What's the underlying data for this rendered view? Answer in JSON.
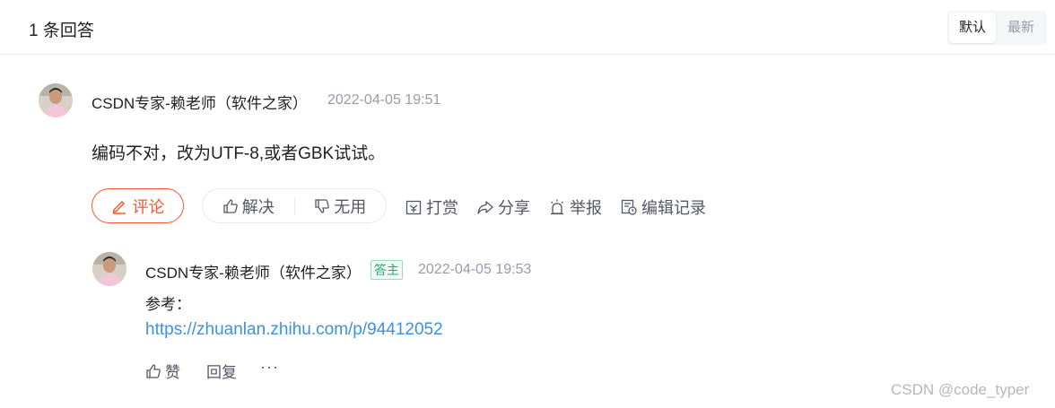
{
  "header": {
    "answer_count": "1 条回答",
    "sort_options": [
      "默认",
      "最新"
    ],
    "active_sort": "默认"
  },
  "answer": {
    "author": "CSDN专家-赖老师（软件之家）",
    "time": "2022-04-05 19:51",
    "content": "编码不对，改为UTF-8,或者GBK试试。",
    "actions": {
      "comment": "评论",
      "solve": "解决",
      "useless": "无用",
      "reward": "打赏",
      "share": "分享",
      "report": "举报",
      "edit_history": "编辑记录"
    }
  },
  "reply": {
    "author": "CSDN专家-赖老师（软件之家）",
    "badge": "答主",
    "time": "2022-04-05 19:53",
    "text": "参考：",
    "link": "https://zhuanlan.zhihu.com/p/94412052",
    "actions": {
      "like": "赞",
      "reply": "回复",
      "more": "···"
    }
  },
  "watermark": "CSDN @code_typer",
  "colors": {
    "accent": "#fc5531",
    "link": "#3e90e0",
    "badge": "#2fa86f",
    "muted": "#999aaa"
  },
  "icons": [
    "pen-icon",
    "thumb-up-icon",
    "thumb-down-icon",
    "gift-icon",
    "share-icon",
    "report-icon",
    "edit-history-icon"
  ]
}
